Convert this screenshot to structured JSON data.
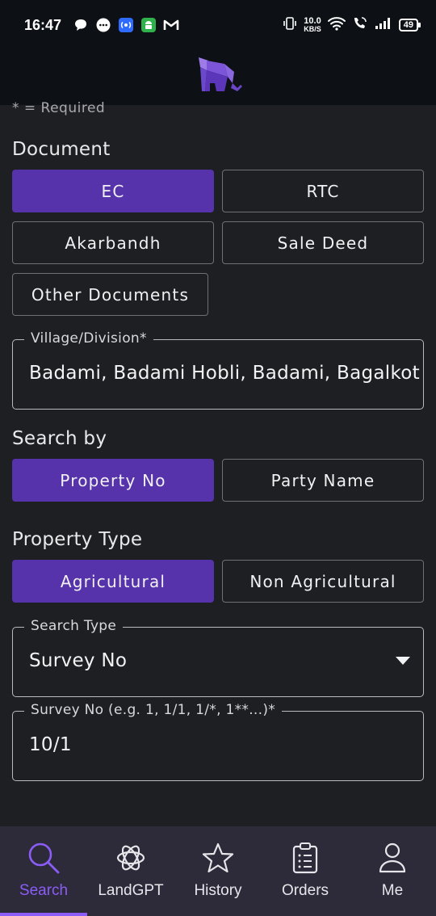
{
  "status_bar": {
    "time": "16:47",
    "network_speed_value": "10.0",
    "network_speed_unit": "KB/S",
    "battery": "49"
  },
  "header": {
    "logo": "elephant-logo"
  },
  "form": {
    "required_note": "* = Required",
    "document_title": "Document",
    "document_options": [
      "EC",
      "RTC",
      "Akarbandh",
      "Sale Deed",
      "Other Documents"
    ],
    "document_selected": "EC",
    "village_label": "Village/Division*",
    "village_value": "Badami, Badami Hobli, Badami, Bagalkot",
    "search_by_title": "Search by",
    "search_by_options": [
      "Property No",
      "Party Name"
    ],
    "search_by_selected": "Property No",
    "property_type_title": "Property Type",
    "property_type_options": [
      "Agricultural",
      "Non Agricultural"
    ],
    "property_type_selected": "Agricultural",
    "search_type_label": "Search Type",
    "search_type_value": "Survey No",
    "survey_label": "Survey No (e.g. 1, 1/1, 1/*, 1**...)*",
    "survey_value": "10/1"
  },
  "bottom_nav": {
    "items": [
      {
        "label": "Search",
        "icon": "search-icon"
      },
      {
        "label": "LandGPT",
        "icon": "openai-icon"
      },
      {
        "label": "History",
        "icon": "star-icon"
      },
      {
        "label": "Orders",
        "icon": "clipboard-icon"
      },
      {
        "label": "Me",
        "icon": "person-icon"
      }
    ],
    "active": "Search"
  },
  "colors": {
    "accent": "#5632ab",
    "nav_accent": "#8b5cf6",
    "background": "#1e1f22",
    "header_bg": "#0d1116",
    "nav_bg": "#2d2b3a"
  }
}
